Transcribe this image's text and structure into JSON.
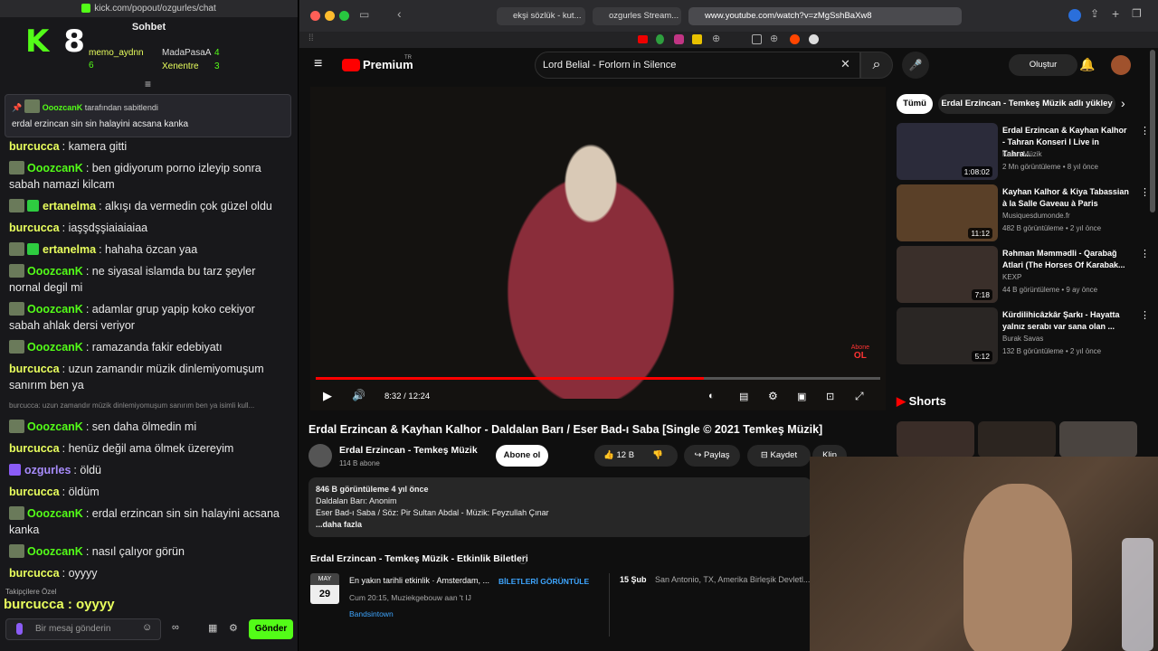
{
  "left_window": {
    "url": "kick.com/popout/ozgurles/chat",
    "header": "Sohbet",
    "logo_letter": "K",
    "logo_number": "8",
    "leaderboard": [
      {
        "name": "memo_aydnn",
        "count": "6"
      },
      {
        "name": "MadaPasaA",
        "count": "4"
      },
      {
        "name": "Xenentre",
        "count": "3"
      }
    ],
    "pinned": {
      "by_user": "OoozcanK",
      "by_suffix": "tarafından sabitlendi",
      "text": "erdal erzincan sin sin halayini acsana kanka"
    },
    "messages": [
      {
        "user": "burcucca",
        "text": "kamera gitti",
        "color": "#e9ff5d"
      },
      {
        "user": "OoozcanK",
        "text": "ben gidiyorum porno izleyip sonra sabah namazi kilcam",
        "color": "#53fc18"
      },
      {
        "user": "ertanelma",
        "text": "alkışı da vermedin çok güzel oldu",
        "color": "#e9ff5d"
      },
      {
        "user": "burcucca",
        "text": "iaşşdşşiaiaiaiaa",
        "color": "#e9ff5d"
      },
      {
        "user": "ertanelma",
        "text": "hahaha özcan yaa",
        "color": "#e9ff5d"
      },
      {
        "user": "OoozcanK",
        "text": "ne siyasal islamda bu tarz şeyler nornal degil mi",
        "color": "#53fc18"
      },
      {
        "user": "OoozcanK",
        "text": "adamlar grup yapip koko cekiyor sabah ahlak dersi veriyor",
        "color": "#53fc18"
      },
      {
        "user": "OoozcanK",
        "text": "ramazanda fakir edebiyatı",
        "color": "#53fc18"
      },
      {
        "user": "burcucca",
        "text": "uzun zamandır müzik dinlemiyomuşum sanırım ben ya",
        "color": "#e9ff5d"
      },
      {
        "user": "OoozcanK",
        "text": "sen daha ölmedin mi",
        "color": "#53fc18"
      },
      {
        "user": "burcucca",
        "text": "henüz değil ama ölmek üzereyim",
        "color": "#e9ff5d"
      },
      {
        "user": "ozgurles",
        "text": "öldü",
        "color": "#a78bfa"
      },
      {
        "user": "burcucca",
        "text": "öldüm",
        "color": "#e9ff5d"
      },
      {
        "user": "OoozcanK",
        "text": "erdal erzincan sin sin halayini acsana kanka",
        "color": "#53fc18"
      },
      {
        "user": "OoozcanK",
        "text": "nasıl çalıyor görün",
        "color": "#53fc18"
      },
      {
        "user": "burcucca",
        "text": "oyyyy",
        "color": "#e9ff5d"
      }
    ],
    "reply_preview": "burcucca: uzun zamandır müzik dinlemiyomuşum sanırım ben ya isimli kull...",
    "followers_label": "Takipçilere Özel",
    "big_message": "burcucca : oyyyy",
    "input_placeholder": "Bir mesaj gönderin",
    "send_label": "Gönder"
  },
  "browser": {
    "tabs": [
      "ekşi sözlük - kut...",
      "ozgurles Stream...",
      "www.youtube.com/watch?v=zMgSshBaXw8"
    ]
  },
  "youtube": {
    "logo": "Premium",
    "logo_sup": "TR",
    "search_value": "Lord Belial - Forlorn in Silence",
    "create_label": "Oluştur",
    "video_title": "Erdal Erzincan & Kayhan Kalhor - Daldalan Barı / Eser Bad-ı Saba [Single © 2021 Temkeş Müzik]",
    "time": "8:32 / 12:24",
    "progress": 0.688,
    "overlay_badge_top": "Abone",
    "overlay_badge_bottom": "OL",
    "channel": "Erdal Erzincan - Temkeş Müzik",
    "subs": "114 B abone",
    "subscribe_label": "Abone ol",
    "likes": "12 B",
    "share_label": "Paylaş",
    "save_label": "Kaydet",
    "clip_label": "Klip",
    "desc_stats": "846 B görüntüleme  4 yıl önce",
    "desc_line1": "Daldalan Barı: Anonim",
    "desc_line2": "Eser Bad-ı Saba / Söz: Pir Sultan Abdal - Müzik: Feyzullah Çınar",
    "desc_more": "...daha fazla",
    "events_title": "Erdal Erzincan - Temkeş Müzik - Etkinlik Biletleri",
    "event_month": "MAY",
    "event_day": "29",
    "event_name": "En yakın tarihli etkinlik · Amsterdam, ...",
    "event_when": "Cum 20:15, Muziekgebouw aan 't IJ",
    "event_source": "Bandsintown",
    "event_btn": "BİLETLERİ GÖRÜNTÜLE",
    "event2_date": "15 Şub",
    "event2_place": "San Antonio, TX, Amerika Birleşik Devletl...",
    "chips": [
      "Tümü",
      "Erdal Erzincan - Temkeş Müzik adlı yükley"
    ],
    "recommendations": [
      {
        "title": "Erdal Erzincan & Kayhan Kalhor - Tahran Konseri I Live in Tahra...",
        "channel": "Kalan Müzik",
        "views": "2 Mn görüntüleme • 8 yıl önce",
        "duration": "1:08:02",
        "thumb": "#2b2b3a"
      },
      {
        "title": "Kayhan Kalhor & Kiya Tabassian à la Salle Gaveau à Paris",
        "channel": "Musiquesdumonde.fr",
        "views": "482 B görüntüleme • 2 yıl önce",
        "duration": "11:12",
        "thumb": "#5a4028"
      },
      {
        "title": "Rəhman Məmmədli - Qarabağ Atlari (The Horses Of Karabak...",
        "channel": "KEXP",
        "views": "44 B görüntüleme • 9 ay önce",
        "duration": "7:18",
        "thumb": "#3a2f2a"
      },
      {
        "title": "Kürdilihicâzkâr Şarkı - Hayatta yalnız serabı var sana olan ...",
        "channel": "Burak Savas",
        "views": "132 B görüntüleme • 2 yıl önce",
        "duration": "5:12",
        "thumb": "#2a2624"
      }
    ],
    "shorts_label": "Shorts"
  }
}
